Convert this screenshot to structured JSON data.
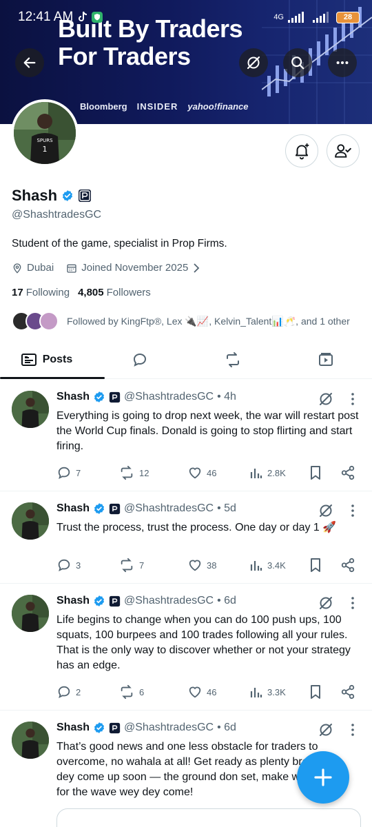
{
  "status_bar": {
    "time": "12:41 AM",
    "network": "4G",
    "battery": "28"
  },
  "banner": {
    "title_line1": "Built By Traders",
    "title_line2": "For Traders",
    "logos": [
      "Bloomberg",
      "INSIDER",
      "yahoo!finance"
    ]
  },
  "header_icons": {
    "back": "arrow-left-icon",
    "grok": "grok-icon",
    "search": "search-icon",
    "more": "more-horizontal-icon"
  },
  "profile": {
    "name": "Shash",
    "handle": "@ShashtradesGC",
    "bio": "Student of the game, specialist in Prop Firms.",
    "location": "Dubai",
    "joined": "Joined November 2025",
    "following_count": "17",
    "following_label": "Following",
    "followers_count": "4,805",
    "followers_label": "Followers",
    "followed_by": "Followed by KingFtp®, Lex 🔌📈, Kelvin_Talent📊🥂, and 1 other"
  },
  "tabs": [
    {
      "label": "Posts",
      "icon": "posts-icon",
      "active": true
    },
    {
      "label": "",
      "icon": "reply-icon"
    },
    {
      "label": "",
      "icon": "repost-icon"
    },
    {
      "label": "",
      "icon": "media-icon"
    }
  ],
  "posts": [
    {
      "name": "Shash",
      "handle": "@ShashtradesGC",
      "time": "• 4h",
      "text": "Everything is going to drop next week, the war will restart post the World Cup finals. Donald is going to stop flirting and start firing.",
      "replies": "7",
      "reposts": "12",
      "likes": "46",
      "views": "2.8K"
    },
    {
      "name": "Shash",
      "handle": "@ShashtradesGC",
      "time": "• 5d",
      "text": "Trust the process, trust the process. One day or day 1 🚀",
      "replies": "3",
      "reposts": "7",
      "likes": "38",
      "views": "3.4K"
    },
    {
      "name": "Shash",
      "handle": "@ShashtradesGC",
      "time": "• 6d",
      "text": "Life begins to change when you can do 100 push ups, 100 squats, 100 burpees and 100 trades following all your rules. That is the only way to discover whether or not your strategy has an edge.",
      "replies": "2",
      "reposts": "6",
      "likes": "46",
      "views": "3.3K"
    },
    {
      "name": "Shash",
      "handle": "@ShashtradesGC",
      "time": "• 6d",
      "text": "That’s good news and one less obstacle for traders to overcome, no wahala at all! Get ready as plenty breakouts dey come up soon — the ground don set, make we prepare for the wave wey dey come!"
    }
  ],
  "colors": {
    "accent": "#1d9bf0",
    "text": "#0f1419",
    "secondary": "#536471"
  }
}
